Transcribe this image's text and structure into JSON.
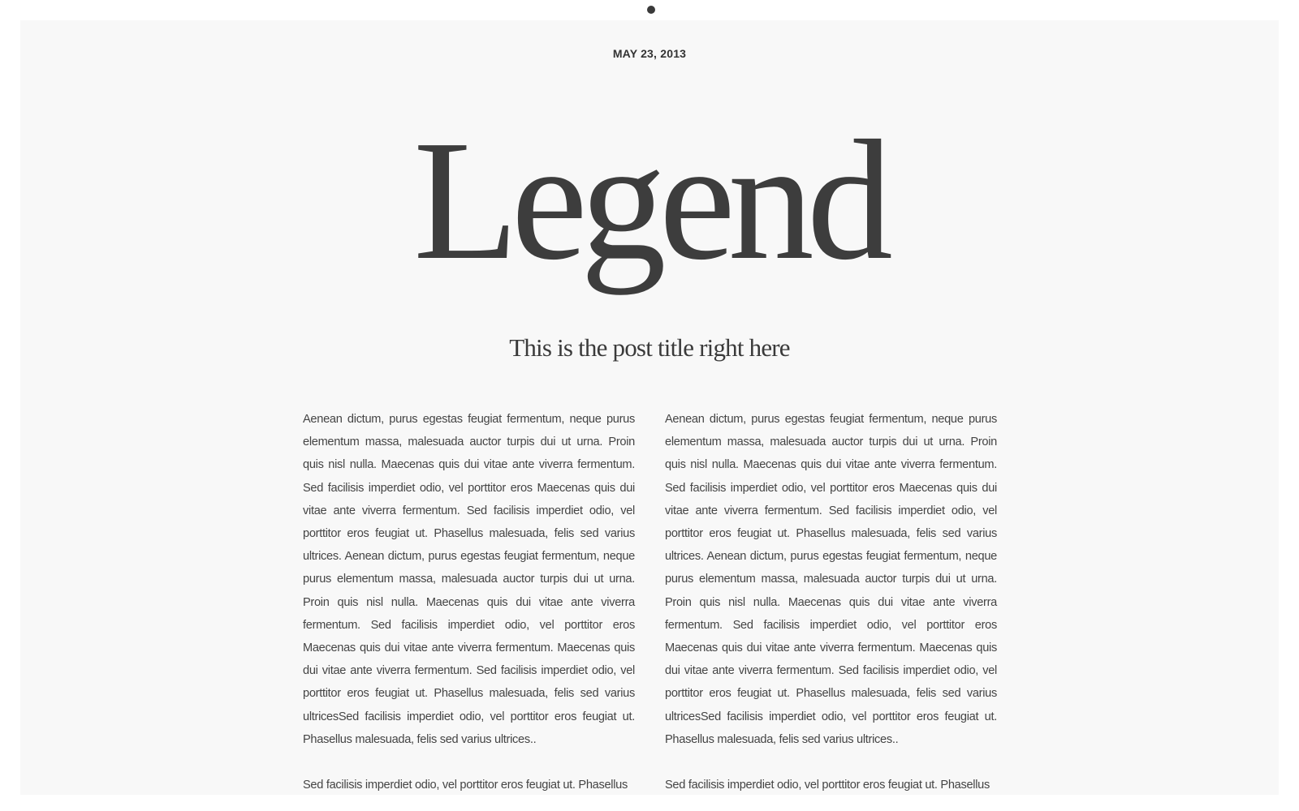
{
  "header": {
    "indicator": "top-dot"
  },
  "post": {
    "date": "MAY 23, 2013",
    "brand": "Legend",
    "title": "This is the post title right here",
    "columns": [
      {
        "paragraphs": [
          "Aenean dictum, purus egestas feugiat fermentum, neque purus elementum massa, malesuada auctor turpis dui ut urna. Proin quis nisl nulla. Maecenas quis dui vitae ante viverra fermentum. Sed facilisis imperdiet odio, vel porttitor eros  Maecenas quis dui vitae ante viverra fermentum. Sed facilisis imperdiet odio, vel porttitor eros feugiat ut. Phasellus malesuada, felis sed varius ultrices. Aenean dictum, purus egestas feugiat fermentum, neque purus elementum massa, malesuada auctor turpis dui ut urna. Proin quis nisl nulla. Maecenas quis dui vitae ante viverra fermentum. Sed facilisis imperdiet odio, vel porttitor eros Maecenas quis dui vitae ante viverra fermentum. Maecenas quis dui vitae ante viverra fermentum. Sed facilisis imperdiet odio, vel porttitor eros feugiat ut. Phasellus malesuada, felis sed varius ultricesSed facilisis imperdiet odio, vel porttitor eros feugiat ut. Phasellus malesuada, felis sed varius ultrices..",
          "Sed facilisis imperdiet odio, vel porttitor eros feugiat ut. Phasellus"
        ]
      },
      {
        "paragraphs": [
          "Aenean dictum, purus egestas feugiat fermentum, neque purus elementum massa, malesuada auctor turpis dui ut urna. Proin quis nisl nulla. Maecenas quis dui vitae ante viverra fermentum. Sed facilisis imperdiet odio, vel porttitor eros  Maecenas quis dui vitae ante viverra fermentum. Sed facilisis imperdiet odio, vel porttitor eros feugiat ut. Phasellus malesuada, felis sed varius ultrices. Aenean dictum, purus egestas feugiat fermentum, neque purus elementum massa, malesuada auctor turpis dui ut urna. Proin quis nisl nulla. Maecenas quis dui vitae ante viverra fermentum. Sed facilisis imperdiet odio, vel porttitor eros Maecenas quis dui vitae ante viverra fermentum. Maecenas quis dui vitae ante viverra fermentum. Sed facilisis imperdiet odio, vel porttitor eros feugiat ut. Phasellus malesuada, felis sed varius ultricesSed facilisis imperdiet odio, vel porttitor eros feugiat ut. Phasellus malesuada, felis sed varius ultrices..",
          "Sed facilisis imperdiet odio, vel porttitor eros feugiat ut. Phasellus"
        ]
      }
    ]
  },
  "colors": {
    "page_background": "#ffffff",
    "panel_background": "#f8f8f8",
    "text": "#3a3a3a"
  }
}
